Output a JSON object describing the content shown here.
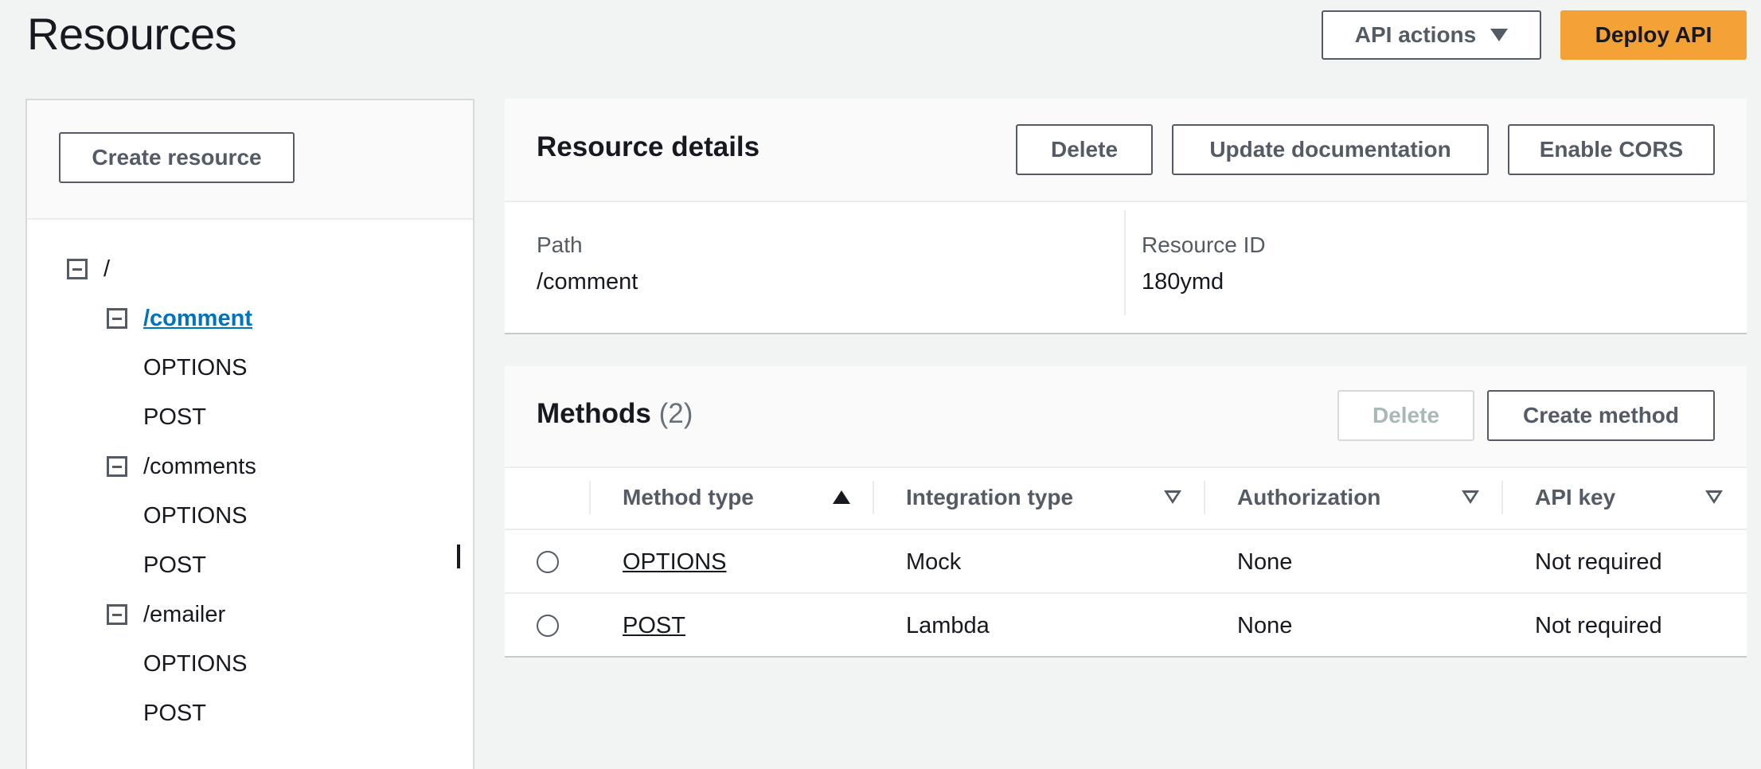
{
  "header": {
    "title": "Resources",
    "api_actions_label": "API actions",
    "deploy_label": "Deploy API"
  },
  "sidebar": {
    "create_resource_label": "Create resource",
    "tree": {
      "root": "/",
      "comment": {
        "path": "/comment",
        "methods": [
          "OPTIONS",
          "POST"
        ]
      },
      "comments": {
        "path": "/comments",
        "methods": [
          "OPTIONS",
          "POST"
        ]
      },
      "emailer": {
        "path": "/emailer",
        "methods": [
          "OPTIONS",
          "POST"
        ]
      }
    }
  },
  "resource_details": {
    "title": "Resource details",
    "delete_label": "Delete",
    "update_doc_label": "Update documentation",
    "enable_cors_label": "Enable CORS",
    "path_label": "Path",
    "path_value": "/comment",
    "id_label": "Resource ID",
    "id_value": "180ymd"
  },
  "methods": {
    "title": "Methods",
    "count": "(2)",
    "delete_label": "Delete",
    "create_label": "Create method",
    "columns": [
      "Method type",
      "Integration type",
      "Authorization",
      "API key"
    ],
    "rows": [
      {
        "method": "OPTIONS",
        "integration": "Mock",
        "authorization": "None",
        "api_key": "Not required"
      },
      {
        "method": "POST",
        "integration": "Lambda",
        "authorization": "None",
        "api_key": "Not required"
      }
    ]
  },
  "colors": {
    "primary": "#f4a236",
    "link": "#0073bb",
    "background": "#f2f3f3"
  }
}
